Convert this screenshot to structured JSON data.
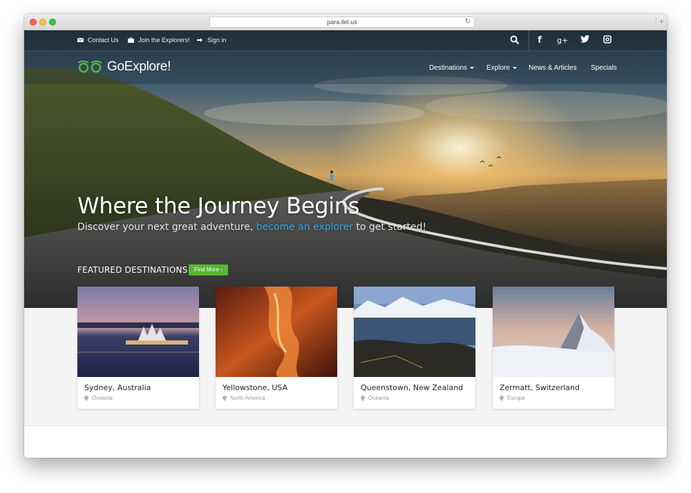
{
  "browser": {
    "url": "para.llel.us"
  },
  "topbar": {
    "contact": "Contact Us",
    "join": "Join the Explorers!",
    "signin": "Sign in",
    "icons": [
      "search-icon",
      "facebook-icon",
      "google-plus-icon",
      "twitter-icon",
      "instagram-icon"
    ]
  },
  "brand": {
    "name": "GoExplore!",
    "accent": "#58b535"
  },
  "nav": {
    "destinations": "Destinations",
    "explore": "Explore",
    "news": "News & Articles",
    "specials": "Specials"
  },
  "hero": {
    "title": "Where the Journey Begins",
    "subtitle_before": "Discover your next great adventure, ",
    "subtitle_link": "become an explorer",
    "subtitle_after": " to get started!",
    "link_color": "#2fa8e0"
  },
  "featured": {
    "heading": "FEATURED DESTINATIONS",
    "button": "Find More",
    "cards": [
      {
        "name": "Sydney, Australia",
        "region": "Oceania"
      },
      {
        "name": "Yellowstone, USA",
        "region": "North America"
      },
      {
        "name": "Queenstown, New Zealand",
        "region": "Oceania"
      },
      {
        "name": "Zermatt, Switzerland",
        "region": "Europe"
      }
    ]
  }
}
